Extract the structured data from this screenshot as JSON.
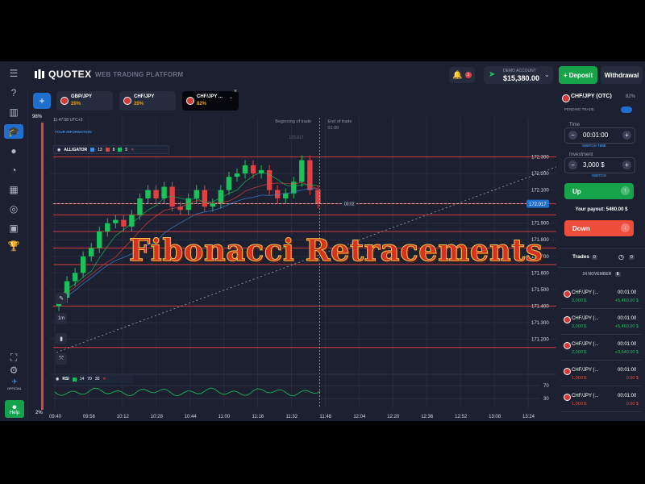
{
  "header": {
    "brand": "QUOTEX",
    "platform": "WEB TRADING PLATFORM",
    "notifications_count": "3",
    "account_label": "DEMO ACCOUNT",
    "account_balance": "$15,380.00",
    "deposit_label": "Deposit",
    "withdrawal_label": "Withdrawal"
  },
  "tabs": [
    {
      "pair": "GBP/JPY",
      "pct": "20%"
    },
    {
      "pair": "CHF/JPY",
      "pct": "20%"
    },
    {
      "pair": "CHF/JPY ...",
      "pct": "82%"
    }
  ],
  "chart": {
    "time_label": "11:47:58  UTC+3",
    "info_label": "YOUR INFORMATION",
    "top_pct": "98%",
    "bottom_pct": "2%",
    "indicator": {
      "name": "ALLIGATOR",
      "p1": "13",
      "p2": "8",
      "p3": "5"
    },
    "rsi": {
      "name": "RSI",
      "p1": "14",
      "p2": "70",
      "p3": "30"
    },
    "rsi_levels": [
      "70",
      "30"
    ],
    "timeframe": "1m",
    "beginning_label": "Beginning of trade",
    "end_label": "End of trade",
    "end_time": "01:00",
    "current_price": "172.017",
    "countdown": "00:02",
    "top_marker": "172.017",
    "overlay_title": "Fibonacci Retracements",
    "price_labels": [
      "172.300",
      "172.200",
      "172.100",
      "171.900",
      "171.800",
      "171.700",
      "171.600",
      "171.500",
      "171.400",
      "171.300",
      "171.200"
    ],
    "time_labels": [
      "09:40",
      "09:56",
      "10:12",
      "10:28",
      "10:44",
      "11:00",
      "11:16",
      "11:32",
      "11:48",
      "12:04",
      "12:20",
      "12:36",
      "12:52",
      "13:08",
      "13:24"
    ],
    "colors": {
      "up": "#19c35a",
      "down": "#e04040",
      "fib": "#d23a3a",
      "bg": "#1c2030"
    }
  },
  "chart_data": {
    "type": "candlestick",
    "x": [
      "09:40",
      "09:44",
      "09:48",
      "09:52",
      "09:56",
      "10:00",
      "10:04",
      "10:08",
      "10:12",
      "10:16",
      "10:20",
      "10:24",
      "10:28",
      "10:32",
      "10:36",
      "10:40",
      "10:44",
      "10:48",
      "10:52",
      "10:56",
      "11:00",
      "11:04",
      "11:08",
      "11:12",
      "11:16",
      "11:20",
      "11:24",
      "11:28",
      "11:32",
      "11:36",
      "11:40",
      "11:44",
      "11:48"
    ],
    "close": [
      171.45,
      171.55,
      171.6,
      171.7,
      171.75,
      171.85,
      171.9,
      171.92,
      171.88,
      171.95,
      172.05,
      172.1,
      172.05,
      172.12,
      172.0,
      171.98,
      172.05,
      172.1,
      172.0,
      172.02,
      172.1,
      172.18,
      172.2,
      172.25,
      172.2,
      172.22,
      172.1,
      172.05,
      172.08,
      172.15,
      172.28,
      172.1,
      172.02
    ],
    "ylim": [
      171.1,
      172.4
    ],
    "fib_levels": [
      172.3,
      172.017,
      171.95,
      171.85,
      171.75,
      171.65,
      171.4,
      171.15
    ],
    "rsi_ylim": [
      0,
      100
    ]
  },
  "panel": {
    "pair": "CHF/JPY (OTC)",
    "pair_pct": "82%",
    "pending": "PENDING TRADE",
    "time_label": "Time",
    "time_value": "00:01:00",
    "switch_time": "SWITCH TIME",
    "investment_label": "Investment",
    "investment_value": "3,000 $",
    "switch": "SWITCH",
    "up_label": "Up",
    "payout": "Your payout: 5460.00 $",
    "down_label": "Down",
    "trades_label": "Trades",
    "trades_count": "0",
    "date_label": "24 NOVEMBER",
    "date_count": "6",
    "trades": [
      {
        "pair": "CHF/JPY (...",
        "time": "00:01:00",
        "amount": "3,000 $",
        "payout": "+5,460.00 $",
        "result": "win"
      },
      {
        "pair": "CHF/JPY (...",
        "time": "00:01:00",
        "amount": "3,000 $",
        "payout": "+5,460.00 $",
        "result": "win"
      },
      {
        "pair": "CHF/JPY (...",
        "time": "00:01:00",
        "amount": "2,000 $",
        "payout": "+3,640.00 $",
        "result": "win"
      },
      {
        "pair": "CHF/JPY (...",
        "time": "00:01:00",
        "amount": "1,000 $",
        "payout": "0.00 $",
        "result": "loss"
      },
      {
        "pair": "CHF/JPY (...",
        "time": "00:01:00",
        "amount": "1,000 $",
        "payout": "0.00 $",
        "result": "loss"
      }
    ]
  },
  "rail": {
    "official": "OFFICIAL",
    "help": "Help"
  }
}
